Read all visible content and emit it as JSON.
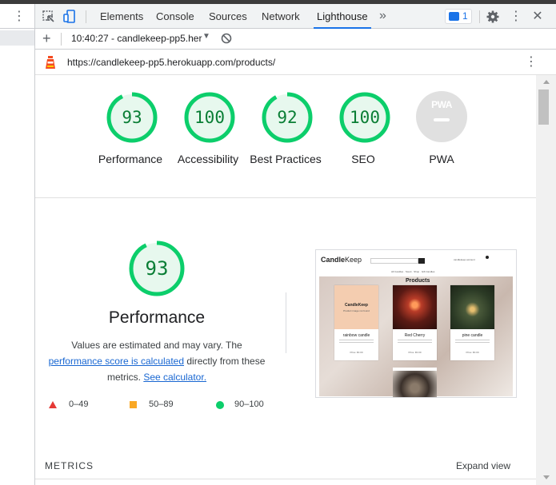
{
  "devtools": {
    "tabs": [
      "Elements",
      "Console",
      "Sources",
      "Network",
      "Lighthouse"
    ],
    "active_tab": "Lighthouse",
    "more_tabs_icon": "»",
    "issues_count": "1"
  },
  "report_bar": {
    "report_label": "10:40:27 - candlekeep-pp5.her",
    "add_icon": "+"
  },
  "url_bar": {
    "url": "https://candlekeep-pp5.herokuapp.com/products/"
  },
  "categories": [
    {
      "label": "Performance",
      "score": "93"
    },
    {
      "label": "Accessibility",
      "score": "100"
    },
    {
      "label": "Best Practices",
      "score": "92"
    },
    {
      "label": "SEO",
      "score": "100"
    },
    {
      "label": "PWA",
      "score": "PWA"
    }
  ],
  "performance": {
    "score": "93",
    "title": "Performance",
    "desc_1": "Values are estimated and may vary. The",
    "link_1": "performance score is calculated",
    "desc_2": "directly from these metrics.",
    "link_2": "See calculator."
  },
  "legend": [
    {
      "range": "0–49",
      "color": "#e53935"
    },
    {
      "range": "50–89",
      "color": "#f9a825"
    },
    {
      "range": "90–100",
      "color": "#0cce6b"
    }
  ],
  "screenshot": {
    "logo_bold": "Candle",
    "logo_light": "Keep",
    "nav": "All Candles · Scent · Shop · Gift Candles",
    "account": "candlekeep account",
    "heading": "Products",
    "products": [
      {
        "name": "rainbow candle",
        "price": "Price: €0.00",
        "card_logo": "CandleKeep",
        "card_sub": "Product image not found"
      },
      {
        "name": "Red Cherry",
        "price": "Price: €0.00"
      },
      {
        "name": "pine candle",
        "price": "Price: €0.00"
      }
    ]
  },
  "metrics": {
    "label": "METRICS",
    "expand": "Expand view"
  },
  "colors": {
    "pass": "#0cce6b",
    "pass_text": "#0a7e35",
    "link": "#1967d2"
  }
}
